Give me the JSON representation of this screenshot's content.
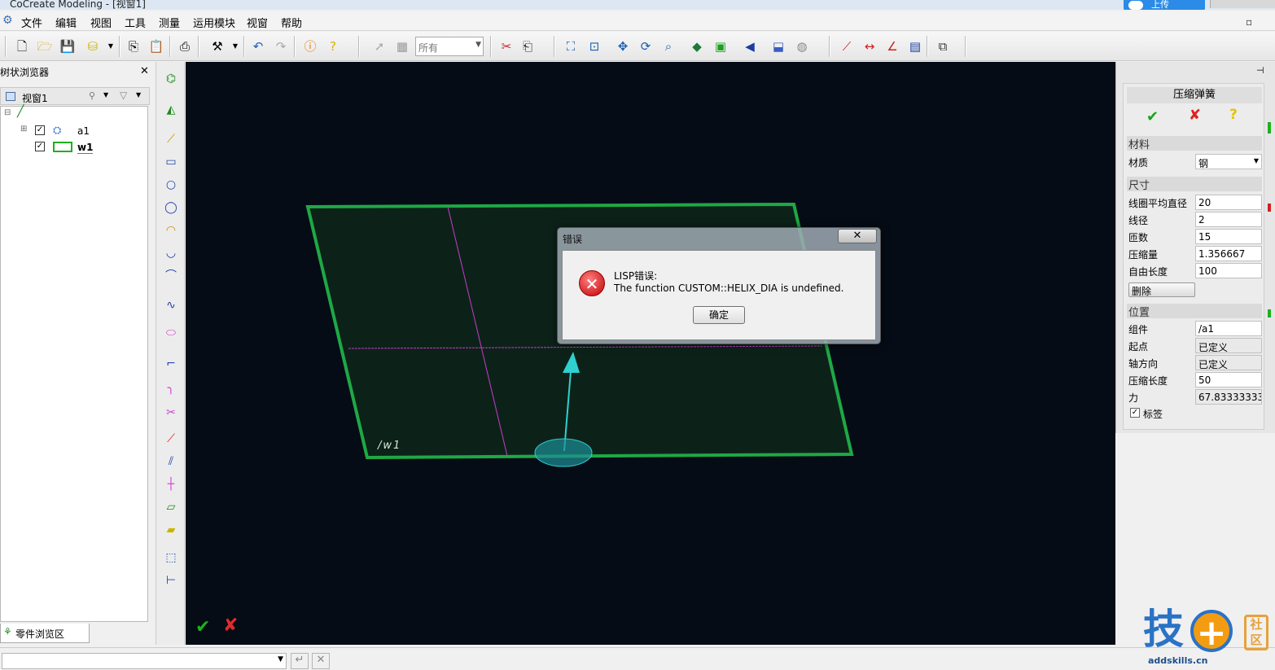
{
  "window": {
    "title": "CoCreate Modeling - [视窗1]",
    "upload_label": "上传"
  },
  "menu": [
    "文件",
    "编辑",
    "视图",
    "工具",
    "测量",
    "运用模块",
    "视窗",
    "帮助"
  ],
  "toolbar": {
    "filter_value": "所有"
  },
  "left_panel": {
    "title": "树状浏览器",
    "view_name": "视窗1",
    "tree": [
      {
        "label": "a1",
        "checked": true
      },
      {
        "label": "w1",
        "checked": true
      }
    ],
    "bottom_tab": "零件浏览区"
  },
  "viewport": {
    "workplane_label": "/w1",
    "colors": {
      "background": "#050c16",
      "workplane_border": "#1fa845",
      "spring_axis": "#2fd0d0",
      "guide_lines": "#c93bc9"
    }
  },
  "property_panel": {
    "title": "压缩弹簧",
    "material_section": "材料",
    "material_label": "材质",
    "material_value": "钢",
    "size_section": "尺寸",
    "size_fields": [
      {
        "label": "线圈平均直径",
        "value": "20"
      },
      {
        "label": "线径",
        "value": "2"
      },
      {
        "label": "匝数",
        "value": "15"
      },
      {
        "label": "压缩量",
        "value": "1.356667"
      },
      {
        "label": "自由长度",
        "value": "100"
      }
    ],
    "delete_label": "删除",
    "position_section": "位置",
    "position_fields": [
      {
        "label": "组件",
        "value": "/a1"
      },
      {
        "label": "起点",
        "value": "已定义"
      },
      {
        "label": "轴方向",
        "value": "已定义"
      },
      {
        "label": "压缩长度",
        "value": "50"
      },
      {
        "label": "力",
        "value": "67.83333333"
      }
    ],
    "label_checkbox": "标签",
    "label_checked": true
  },
  "dialog": {
    "title": "错误",
    "message_line1": "LISP错误:",
    "message_line2": "The function CUSTOM::HELIX_DIA is undefined.",
    "ok_label": "确定",
    "close_symbol": "✕"
  },
  "watermark": {
    "char": "技",
    "plus": "+",
    "box_text": "社区",
    "url": "addskills.cn"
  }
}
